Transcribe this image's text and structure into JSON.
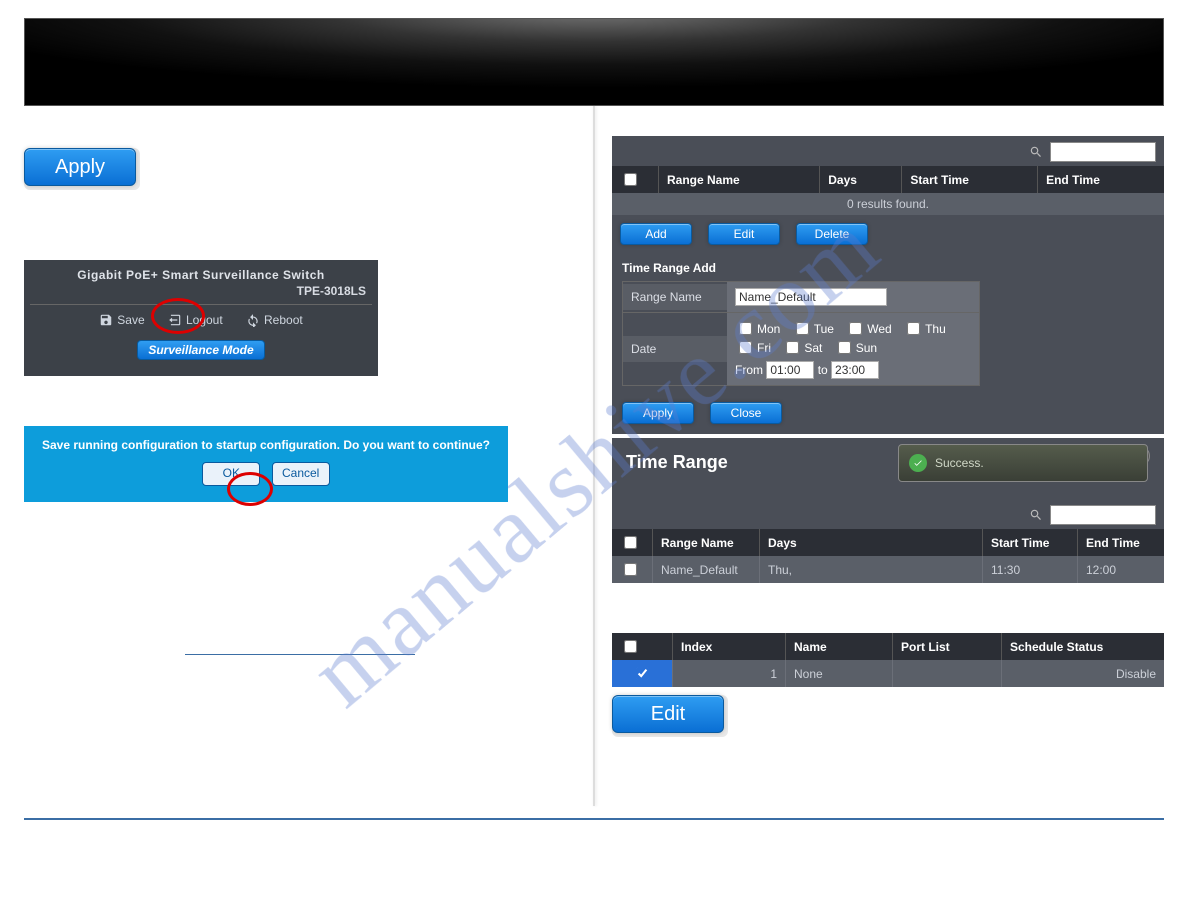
{
  "watermark": "manualshive.com",
  "apply_big": "Apply",
  "edit_big": "Edit",
  "switch": {
    "title": "Gigabit PoE+ Smart Surveillance Switch",
    "model": "TPE-3018LS",
    "save": "Save",
    "logout": "Logout",
    "reboot": "Reboot",
    "surv_mode": "Surveillance Mode"
  },
  "confirm": {
    "message": "Save running configuration to startup configuration. Do you want to continue?",
    "ok": "OK",
    "cancel": "Cancel"
  },
  "time_range_empty": {
    "headers": {
      "range_name": "Range Name",
      "days": "Days",
      "start": "Start Time",
      "end": "End Time"
    },
    "no_results": "0 results found.",
    "buttons": {
      "add": "Add",
      "edit": "Edit",
      "delete": "Delete"
    },
    "add": {
      "title": "Time Range Add",
      "range_name_label": "Range Name",
      "range_name_value": "Name_Default",
      "date_label": "Date",
      "days": {
        "mon": "Mon",
        "tue": "Tue",
        "wed": "Wed",
        "thu": "Thu",
        "fri": "Fri",
        "sat": "Sat",
        "sun": "Sun"
      },
      "from_label": "From",
      "from_value": "01:00",
      "to_label": "to",
      "to_value": "23:00",
      "apply": "Apply",
      "close": "Close"
    }
  },
  "time_range_filled": {
    "title": "Time Range",
    "toast": "Success.",
    "headers": {
      "range_name": "Range Name",
      "days": "Days",
      "start": "Start Time",
      "end": "End Time"
    },
    "row": {
      "name": "Name_Default",
      "days": "Thu,",
      "start": "11:30",
      "end": "12:00"
    }
  },
  "schedule": {
    "headers": {
      "index": "Index",
      "name": "Name",
      "port_list": "Port List",
      "status": "Schedule Status"
    },
    "row": {
      "index": "1",
      "name": "None",
      "port": "",
      "status": "Disable"
    }
  }
}
